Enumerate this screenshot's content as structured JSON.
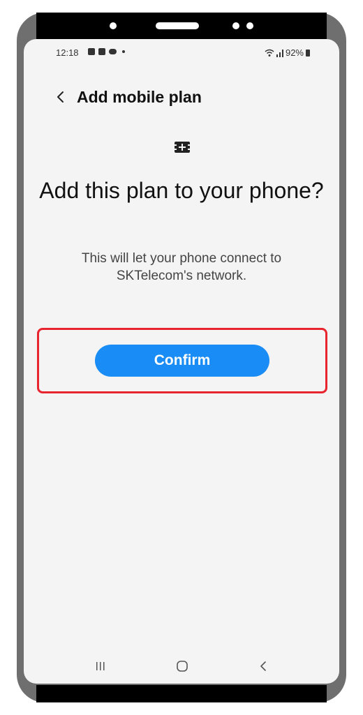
{
  "status_bar": {
    "time": "12:18",
    "battery": "92%",
    "left_icons": [
      "notification-icon",
      "gallery-icon",
      "cloud-icon",
      "dot-icon"
    ],
    "right_icons": [
      "wifi-icon",
      "signal-icon",
      "battery-icon"
    ]
  },
  "header": {
    "title": "Add mobile plan",
    "back_icon": "chevron-left-icon"
  },
  "content": {
    "icon": "sim-card-add-icon",
    "heading": "Add this plan to your phone?",
    "description": "This will let your phone connect to SKTelecom's network."
  },
  "actions": {
    "confirm_label": "Confirm"
  },
  "nav_bar": {
    "buttons": [
      "recent-apps-icon",
      "home-icon",
      "back-icon"
    ]
  },
  "colors": {
    "accent": "#1a8cf5",
    "highlight": "#e8242f",
    "background": "#f4f4f4"
  }
}
